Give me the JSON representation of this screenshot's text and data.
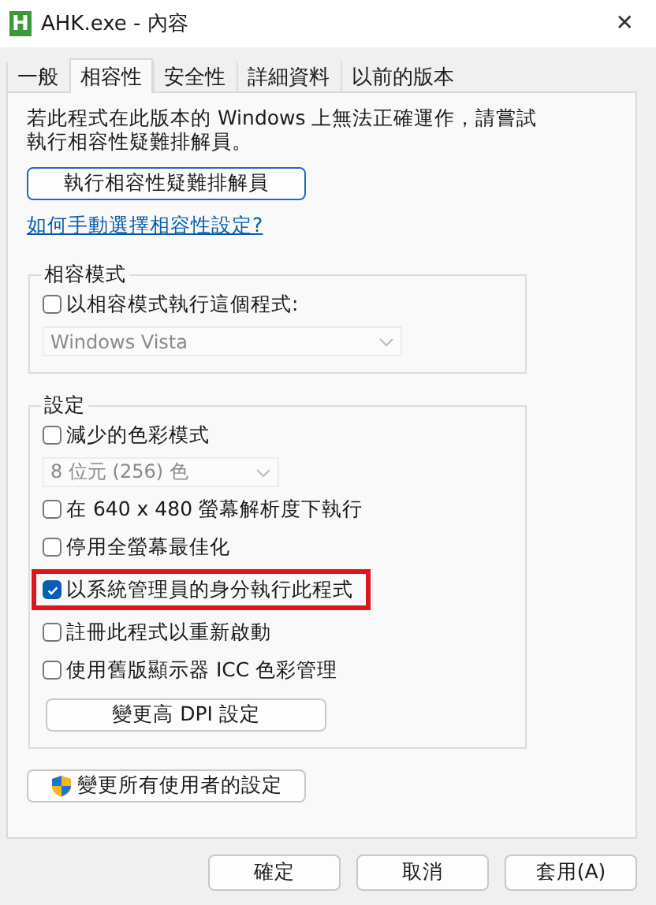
{
  "window": {
    "title": "AHK.exe - 內容",
    "app_icon_letter": "H",
    "close": "✕"
  },
  "tabs": [
    {
      "label": "一般",
      "selected": false
    },
    {
      "label": "相容性",
      "selected": true
    },
    {
      "label": "安全性",
      "selected": false
    },
    {
      "label": "詳細資料",
      "selected": false
    },
    {
      "label": "以前的版本",
      "selected": false
    }
  ],
  "description": "若此程式在此版本的 Windows 上無法正確運作，請嘗試執行相容性疑難排解員。",
  "troubleshoot_button": "執行相容性疑難排解員",
  "help_link": "如何手動選擇相容性設定?",
  "compat_group": {
    "legend": "相容模式",
    "items": [
      {
        "kind": "checkbox",
        "label": "以相容模式執行這個程式:",
        "checked": false,
        "highlighted": false
      },
      {
        "kind": "dropdown",
        "value": "Windows Vista",
        "disabled": true
      }
    ]
  },
  "settings_group": {
    "legend": "設定",
    "items": [
      {
        "kind": "checkbox",
        "label": "減少的色彩模式",
        "checked": false,
        "highlighted": false
      },
      {
        "kind": "dropdown",
        "value": "8 位元 (256) 色",
        "disabled": true
      },
      {
        "kind": "checkbox",
        "label": "在 640 x 480 螢幕解析度下執行",
        "checked": false,
        "highlighted": false
      },
      {
        "kind": "checkbox",
        "label": "停用全螢幕最佳化",
        "checked": false,
        "highlighted": false
      },
      {
        "kind": "checkbox",
        "label": "以系統管理員的身分執行此程式",
        "checked": true,
        "highlighted": true
      },
      {
        "kind": "checkbox",
        "label": "註冊此程式以重新啟動",
        "checked": false,
        "highlighted": false
      },
      {
        "kind": "checkbox",
        "label": "使用舊版顯示器 ICC 色彩管理",
        "checked": false,
        "highlighted": false
      },
      {
        "kind": "button",
        "label": "變更高 DPI 設定"
      }
    ]
  },
  "all_users_button": "變更所有使用者的設定",
  "buttons": [
    "確定",
    "取消",
    "套用(A)"
  ]
}
